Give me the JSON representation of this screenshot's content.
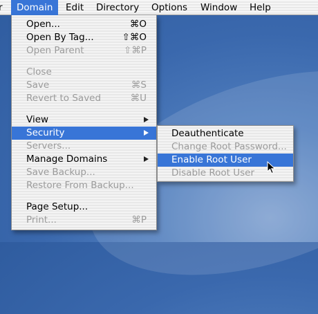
{
  "menubar": {
    "items": [
      {
        "label": "r"
      },
      {
        "label": "Domain"
      },
      {
        "label": "Edit"
      },
      {
        "label": "Directory"
      },
      {
        "label": "Options"
      },
      {
        "label": "Window"
      },
      {
        "label": "Help"
      }
    ],
    "active": "Domain"
  },
  "domain_menu": {
    "items": [
      {
        "label": "Open...",
        "shortcut": "⌘O",
        "enabled": true
      },
      {
        "label": "Open By Tag...",
        "shortcut": "⇧⌘O",
        "enabled": true
      },
      {
        "label": "Open Parent",
        "shortcut": "⇧⌘P",
        "enabled": false
      },
      {
        "label": "Close",
        "shortcut": "",
        "enabled": false
      },
      {
        "label": "Save",
        "shortcut": "⌘S",
        "enabled": false
      },
      {
        "label": "Revert to Saved",
        "shortcut": "⌘U",
        "enabled": false
      },
      {
        "label": "View",
        "shortcut": "",
        "enabled": true,
        "submenu": true
      },
      {
        "label": "Security",
        "shortcut": "",
        "enabled": true,
        "submenu": true,
        "highlighted": true
      },
      {
        "label": "Servers...",
        "shortcut": "",
        "enabled": false
      },
      {
        "label": "Manage Domains",
        "shortcut": "",
        "enabled": true,
        "submenu": true
      },
      {
        "label": "Save Backup...",
        "shortcut": "",
        "enabled": false
      },
      {
        "label": "Restore From Backup...",
        "shortcut": "",
        "enabled": false
      },
      {
        "label": "Page Setup...",
        "shortcut": "",
        "enabled": true
      },
      {
        "label": "Print...",
        "shortcut": "⌘P",
        "enabled": false
      }
    ]
  },
  "security_submenu": {
    "items": [
      {
        "label": "Deauthenticate",
        "enabled": true
      },
      {
        "label": "Change Root Password...",
        "enabled": false
      },
      {
        "label": "Enable Root User",
        "enabled": true,
        "highlighted": true
      },
      {
        "label": "Disable Root User",
        "enabled": false
      }
    ]
  },
  "colors": {
    "highlight": "#3875d7",
    "disabled_text": "#9b9b9b",
    "desktop": "#3a68ad"
  }
}
